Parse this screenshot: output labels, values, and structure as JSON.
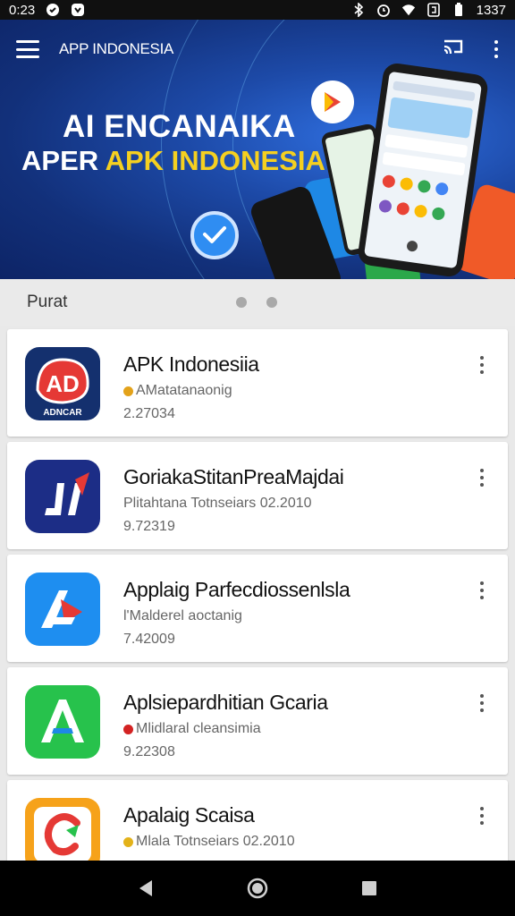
{
  "status_bar": {
    "time": "0:23",
    "right_text": "1337"
  },
  "toolbar": {
    "title": "APP INDONESIA"
  },
  "banner": {
    "headline_line1": "AI ENCANAIKA",
    "headline_line2_prefix": "APER",
    "headline_line2_accent": "APK INDONESIA",
    "accent_color": "#f5d020"
  },
  "section": {
    "title": "Purat"
  },
  "apps": [
    {
      "name": "APK Indonesiia",
      "subtitle": "AMatatanaonig",
      "meta": "2.27034",
      "icon": "apk-logo-icon",
      "badge_color": "#e3a21a",
      "icon_bg": "#14306e",
      "icon_label": "ADNCAR"
    },
    {
      "name": "GoriakaStitanPreaMajdai",
      "subtitle": "Plitahtana Totnseiars  02.2010",
      "meta": "9.72319",
      "icon": "ji-logo-icon",
      "badge_color": "",
      "icon_bg": "#1c2d86",
      "icon_label": ""
    },
    {
      "name": "Applaig Parfecdiossenlsla",
      "subtitle": "l'Malderel aoctanig",
      "meta": "7.42009",
      "icon": "a-arrow-logo-icon",
      "badge_color": "",
      "icon_bg": "#1e8ef0",
      "icon_label": ""
    },
    {
      "name": "Aplsiepardhitian Gcaria",
      "subtitle": "Mlidlaral cleansimia",
      "meta": "9.22308",
      "icon": "a-green-logo-icon",
      "badge_color": "#d32222",
      "icon_bg": "#27c24c",
      "icon_label": ""
    },
    {
      "name": "Apalaig Scaisa",
      "subtitle": "Mlala Totnseiars  02.2010",
      "meta": "",
      "icon": "c-logo-icon",
      "badge_color": "#e3b21a",
      "icon_bg": "#f6a21a",
      "icon_label": ""
    }
  ]
}
